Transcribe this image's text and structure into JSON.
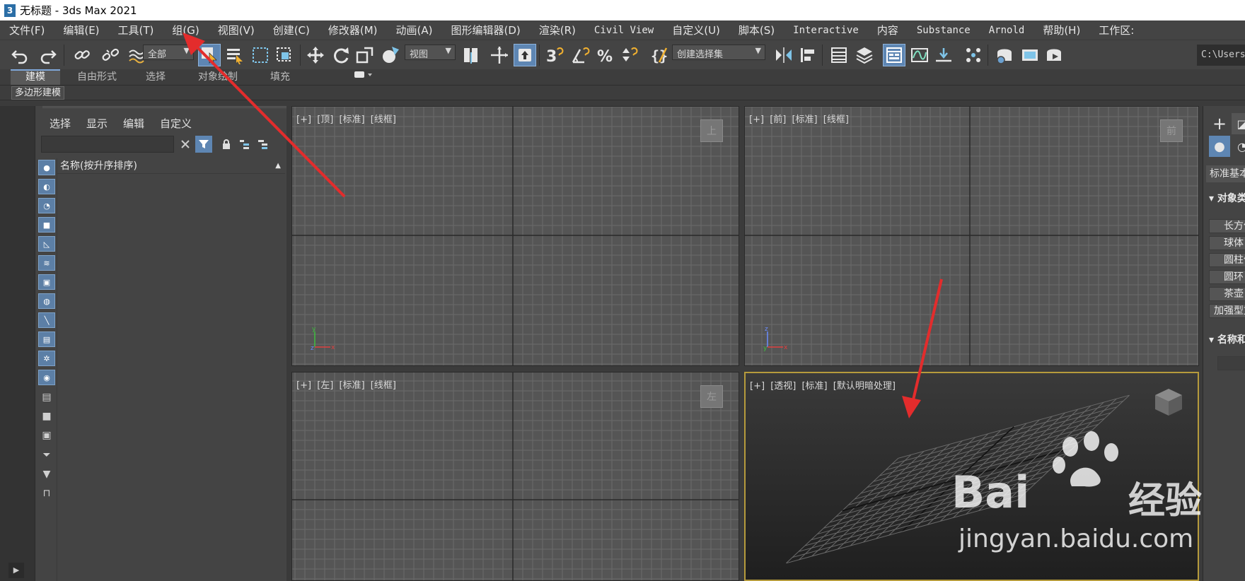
{
  "window": {
    "title": "无标题 - 3ds Max 2021",
    "app_icon": "3"
  },
  "menu": [
    {
      "label": "文件(F)"
    },
    {
      "label": "编辑(E)"
    },
    {
      "label": "工具(T)"
    },
    {
      "label": "组(G)"
    },
    {
      "label": "视图(V)"
    },
    {
      "label": "创建(C)"
    },
    {
      "label": "修改器(M)"
    },
    {
      "label": "动画(A)"
    },
    {
      "label": "图形编辑器(D)"
    },
    {
      "label": "渲染(R)"
    },
    {
      "label": "Civil View"
    },
    {
      "label": "自定义(U)"
    },
    {
      "label": "脚本(S)"
    },
    {
      "label": "Interactive"
    },
    {
      "label": "内容"
    },
    {
      "label": "Substance"
    },
    {
      "label": "Arnold"
    },
    {
      "label": "帮助(H)"
    },
    {
      "label": "工作区:"
    }
  ],
  "toolbar": {
    "selection_filter": "全部",
    "reference_coord": "视图",
    "named_selection": "创建选择集",
    "path_text": "C:\\Users\\"
  },
  "ribbon": {
    "tabs": [
      "建模",
      "自由形式",
      "选择",
      "对象绘制",
      "填充"
    ],
    "panel_label": "多边形建模"
  },
  "scene_explorer": {
    "menu": [
      "选择",
      "显示",
      "编辑",
      "自定义"
    ],
    "search_placeholder": "",
    "column_header": "名称(按升序排序)"
  },
  "viewports": {
    "top": {
      "labels": [
        "[+]",
        "[顶]",
        "[标准]",
        "[线框]"
      ],
      "cube_text": "上"
    },
    "front": {
      "labels": [
        "[+]",
        "[前]",
        "[标准]",
        "[线框]"
      ],
      "cube_text": "前"
    },
    "left": {
      "labels": [
        "[+]",
        "[左]",
        "[标准]",
        "[线框]"
      ],
      "cube_text": "左"
    },
    "perspective": {
      "labels": [
        "[+]",
        "[透视]",
        "[标准]",
        "[默认明暗处理]"
      ]
    }
  },
  "command_panel": {
    "dropdown": "标准基本体",
    "rollout_object_type": "对象类型",
    "buttons": [
      "长方体",
      "球体",
      "圆柱体",
      "圆环",
      "茶壶",
      "加强型文本"
    ],
    "rollout_name": "名称和颜色"
  },
  "watermark": {
    "brand": "Bai",
    "brand2": "经验",
    "sub": "jingyan.baidu.com"
  },
  "colors": {
    "active_blue": "#5e86b3",
    "arrow_red": "#e32c2c",
    "viewport_active": "#b69b3c"
  }
}
